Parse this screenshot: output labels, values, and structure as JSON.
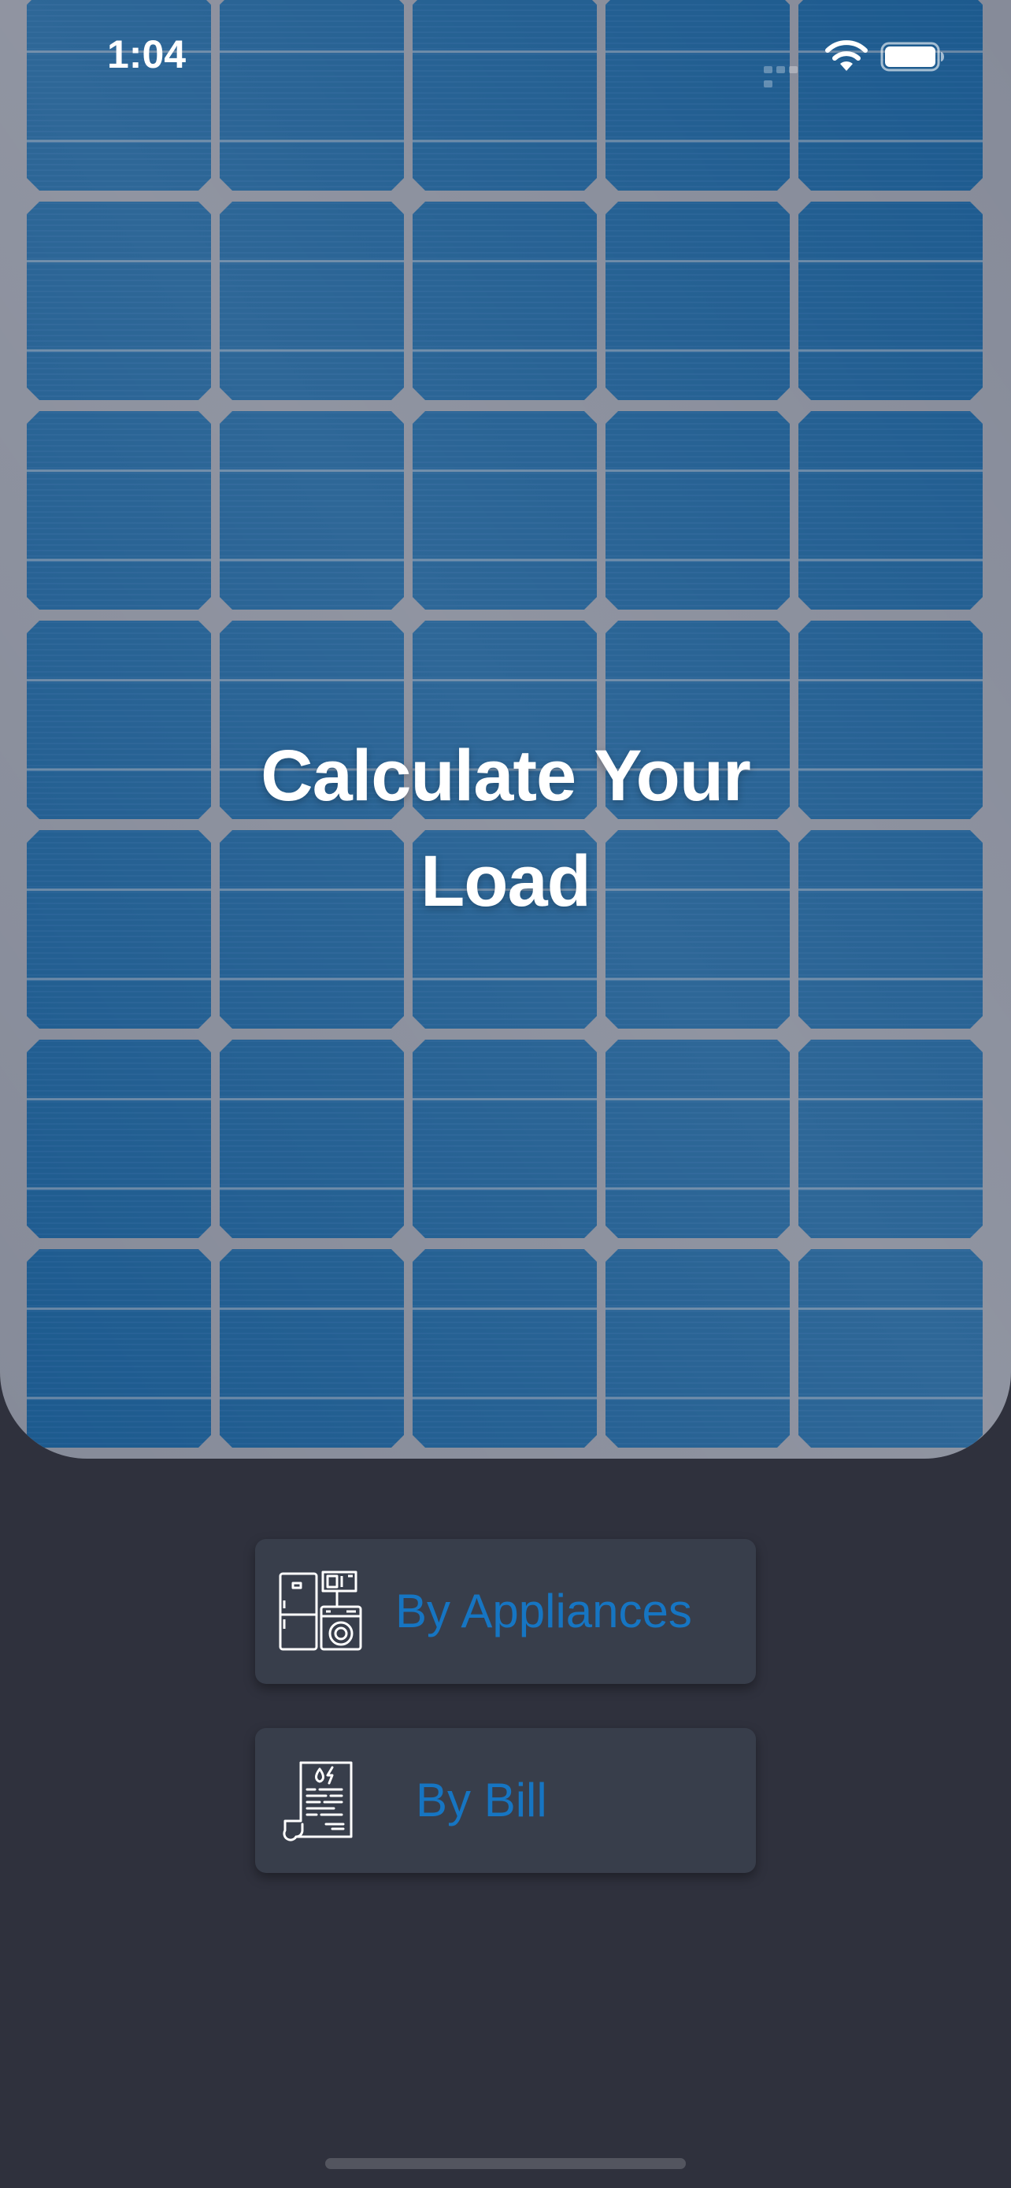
{
  "status_bar": {
    "time": "1:04",
    "icons": [
      "cellular-signal-icon",
      "wifi-icon",
      "battery-icon"
    ]
  },
  "hero": {
    "background": "solar-panel",
    "title_line1": "Calculate Your",
    "title_line2": "Load"
  },
  "options": [
    {
      "label": "By Appliances",
      "icon": "appliances-icon"
    },
    {
      "label": "By Bill",
      "icon": "bill-receipt-icon"
    }
  ],
  "colors": {
    "background": "#2f313d",
    "button_bg": "#383e4b",
    "button_text": "#1675c2",
    "panel_cell": "#1c5a8e",
    "panel_frame": "#868b99",
    "title_text": "#ffffff"
  }
}
